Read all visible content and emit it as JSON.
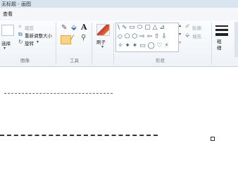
{
  "window": {
    "title": "无标题 - 画图"
  },
  "menu": {
    "view_tab": "查看"
  },
  "ribbon": {
    "image_group": {
      "select_label": "选择",
      "crop_label": "裁剪",
      "resize_label": "重新调整大小",
      "rotate_label": "旋转",
      "group_label": "图像"
    },
    "tools_group": {
      "text_tool": "A",
      "group_label": "工具"
    },
    "brushes_group": {
      "label": "刷子"
    },
    "shapes_group": {
      "shapes_row1": "\\ ∿ ▭ ⬭ ▢ △ ⊿",
      "shapes_row2": "◇ ⬠ ⬡ ⇨ ⇦ ⇧ ⇩",
      "shapes_row3": "✧ ✦ ✶ ▭ ◯ ♡ ⚡",
      "outline_label": "轮廓",
      "fill_label": "填充",
      "group_label": "形状"
    },
    "size_group": {
      "label": "粗细"
    }
  },
  "colors": {
    "accent": "#3d6fa8",
    "ribbon_bg": "#eef2f7",
    "title_bg": "#d9e4f1"
  }
}
